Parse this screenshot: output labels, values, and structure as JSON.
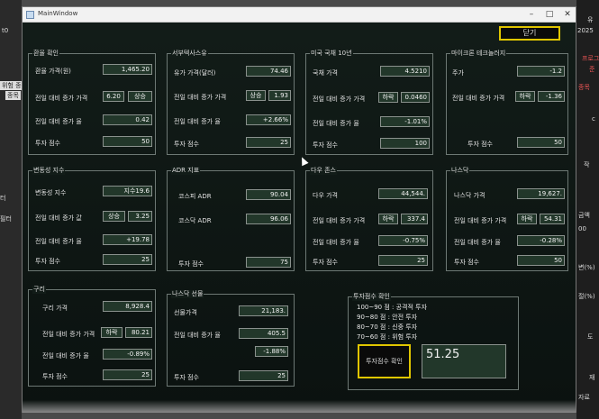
{
  "window": {
    "title": "MainWindow"
  },
  "close_label": "닫기",
  "background": {
    "left_snips": [
      "t0",
      "위험 종",
      "종목",
      "터",
      "필터"
    ],
    "right_snips": [
      "유",
      "2025",
      "프로그",
      "준",
      "종목",
      "c",
      "작",
      "금액",
      "00",
      "변(%)",
      "절(%)",
      "도",
      "재",
      "자료"
    ]
  },
  "panels": {
    "fx": {
      "title": "환율 확인",
      "rate_label": "환율 가격(원)",
      "rate": "1,465.20",
      "change_label": "전일 대비 증가 가격",
      "change": "6.20",
      "change_dir": "상승",
      "pct_label": "전일 대비 증가 율",
      "pct": "0.42",
      "score_label": "투자 점수",
      "score": "50"
    },
    "wti": {
      "title": "서부텍사스유",
      "price_label": "유가 가격(달러)",
      "price": "74.46",
      "change_label": "전일 대비 증가 가격",
      "change_dir": "상승",
      "change": "1.93",
      "pct_label": "전일 대비 증가 율",
      "pct": "+2.66%",
      "score_label": "투자 점수",
      "score": "25"
    },
    "us10y": {
      "title": "미국 국채 10년",
      "price_label": "국채 가격",
      "price": "4.5210",
      "change_label": "전일 대비 증가 가격",
      "change_dir": "하락",
      "change": "0.0460",
      "pct_label": "전일 대비 증가 율",
      "pct": "-1.01%",
      "score_label": "투자 점수",
      "score": "100"
    },
    "micron": {
      "title": "마이크론 테크놀러지",
      "price_label": "주가",
      "price": "-1.2",
      "change_label": "전일 대비 증가 가격",
      "change_dir": "하락",
      "change": "-1.36",
      "score_label": "투자 점수",
      "score": "50"
    },
    "vix": {
      "title": "변동성 지수",
      "index_label": "변동성 지수",
      "index": "지수19.6",
      "change_label": "전일 대비 증가 값",
      "change_dir": "상승",
      "change": "3.25",
      "pct_label": "전일 대비 증가 율",
      "pct": "+19.78",
      "score_label": "투자 점수",
      "score": "25"
    },
    "adr": {
      "title": "ADR 지표",
      "kospi_label": "코스피 ADR",
      "kospi": "90.04",
      "kosdaq_label": "코스닥 ADR",
      "kosdaq": "96.06",
      "score_label": "투자 점수",
      "score": "75"
    },
    "dow": {
      "title": "다우 존스",
      "price_label": "다우 가격",
      "price": "44,544.",
      "change_label": "전일 대비 증가 가격",
      "change_dir": "하락",
      "change": "337.4",
      "pct_label": "전일 대비 증가 율",
      "pct": "-0.75%",
      "score_label": "투자 점수",
      "score": "25"
    },
    "nasdaq": {
      "title": "나스닥",
      "price_label": "나스닥 가격",
      "price": "19,627.",
      "change_label": "전일 대비 증가 가격",
      "change_dir": "하락",
      "change": "54.31",
      "pct_label": "전일 대비 증가 율",
      "pct": "-0.28%",
      "score_label": "투자 점수",
      "score": "50"
    },
    "copper": {
      "title": "구리",
      "price_label": "구리 가격",
      "price": "8,928.4",
      "change_label": "전일 대비 증가 가격",
      "change_dir": "하락",
      "change": "80.21",
      "pct_label": "전일 대비 증가 율",
      "pct": "-0.89%",
      "score_label": "투자 점수",
      "score": "25"
    },
    "nasdaq_fut": {
      "title": "나스닥 선물",
      "price_label": "선물가격",
      "price": "21,183.",
      "change_label": "전일 대비 증가 율",
      "change": "405.5",
      "pct": "-1.88%",
      "score_label": "투자 점수",
      "score": "25"
    },
    "score_check": {
      "title": "투자점수 확인",
      "guide": [
        "100~90 점 : 공격적 투자",
        "90~80 점 : 안전 투자",
        "80~70 점 : 신중 투자",
        "70~60 점 : 위험 투자"
      ],
      "button_label": "투자점수 확인",
      "result": "51.25"
    }
  }
}
